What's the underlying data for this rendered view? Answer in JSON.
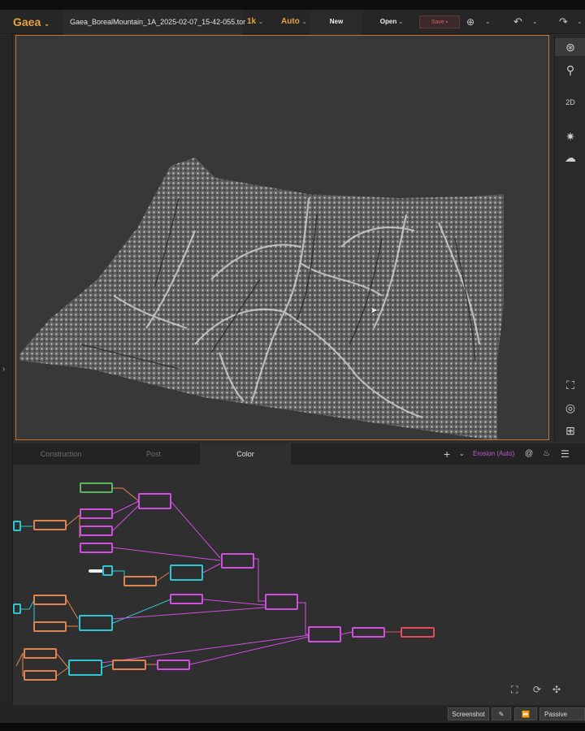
{
  "app": {
    "name": "Gaea",
    "file_name": "Gaea_BorealMountain_1A_2025-02-07_15-42-055.tor",
    "resolution": "1k",
    "build_mode": "Auto"
  },
  "toolbar": {
    "new_label": "New",
    "open_label": "Open",
    "save_label": "Save"
  },
  "right_toolbar": {
    "view_2d_label": "2D"
  },
  "graph_panel": {
    "tabs": [
      {
        "label": "Construction",
        "active": false
      },
      {
        "label": "Post",
        "active": false
      },
      {
        "label": "Color",
        "active": true
      }
    ],
    "selected_node_label": "Erosion (Auto)"
  },
  "status_bar": {
    "screenshot_label": "Screenshot",
    "passive_label": "Passive Optimi"
  },
  "colors": {
    "accent": "#e8a33d",
    "viewport_border": "#c8752b",
    "node_cyan": "#2ec6d3",
    "node_orange": "#e08452",
    "node_magenta": "#d14fe0",
    "node_green": "#58b85f",
    "node_red": "#e24b5f",
    "save_red": "#e45a5a"
  }
}
